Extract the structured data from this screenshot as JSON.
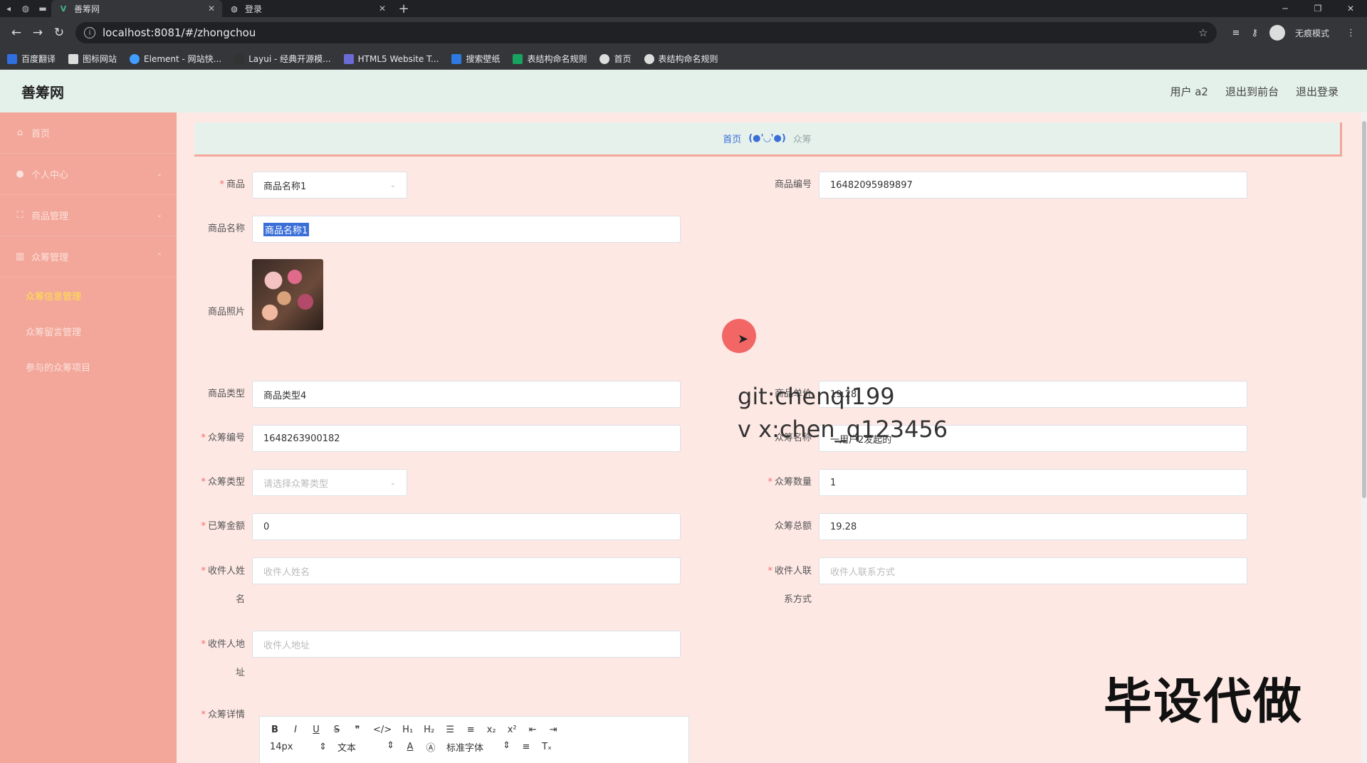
{
  "browser": {
    "tabs": [
      {
        "title": "善筹网",
        "active": true
      },
      {
        "title": "登录",
        "active": false
      }
    ],
    "url": "localhost:8081/#/zhongchou",
    "incognito_label": "无痕模式",
    "bookmarks": [
      "百度翻译",
      "图标网站",
      "Element - 网站快...",
      "Layui - 经典开源模...",
      "HTML5 Website T...",
      "搜索壁纸",
      "表结构命名规则",
      "首页",
      "表结构命名规则"
    ]
  },
  "header": {
    "logo": "善筹网",
    "user": "用户 a2",
    "back_front": "退出到前台",
    "logout": "退出登录"
  },
  "sidebar": {
    "items": [
      {
        "label": "首页",
        "icon": "home-icon"
      },
      {
        "label": "个人中心",
        "icon": "user-icon"
      },
      {
        "label": "商品管理",
        "icon": "grid-icon"
      },
      {
        "label": "众筹管理",
        "icon": "chart-icon"
      }
    ],
    "subitems": [
      {
        "label": "众筹信息管理",
        "active": true
      },
      {
        "label": "众筹留言管理",
        "active": false
      },
      {
        "label": "参与的众筹项目",
        "active": false
      }
    ]
  },
  "breadcrumb": {
    "home": "首页",
    "sep": "(●'◡'●)",
    "current": "众筹"
  },
  "form": {
    "product_label": "商品",
    "product_value": "商品名称1",
    "product_no_label": "商品编号",
    "product_no_value": "16482095989897",
    "product_name_label": "商品名称",
    "product_name_value": "商品名称1",
    "photo_label": "商品照片",
    "product_type_label": "商品类型",
    "product_type_value": "商品类型4",
    "price_label": "商品单价",
    "price_value": "19.28",
    "cf_no_label": "众筹编号",
    "cf_no_value": "1648263900182",
    "cf_name_label": "众筹名称",
    "cf_name_value": "一用户2发起的",
    "cf_type_label": "众筹类型",
    "cf_type_placeholder": "请选择众筹类型",
    "cf_qty_label": "众筹数量",
    "cf_qty_value": "1",
    "raised_label": "已筹金额",
    "raised_value": "0",
    "total_label": "众筹总额",
    "total_value": "19.28",
    "receiver_name_label_1": "收件人姓",
    "receiver_name_label_2": "名",
    "receiver_name_placeholder": "收件人姓名",
    "receiver_contact_label_1": "收件人联",
    "receiver_contact_label_2": "系方式",
    "receiver_contact_placeholder": "收件人联系方式",
    "receiver_addr_label_1": "收件人地",
    "receiver_addr_label_2": "址",
    "receiver_addr_placeholder": "收件人地址",
    "detail_label": "众筹详情"
  },
  "editor": {
    "row1": [
      "B",
      "I",
      "U",
      "S",
      "❞",
      "</>",
      "H₁",
      "H₂",
      "☰",
      "≡",
      "x₂",
      "x²",
      "⇤",
      "⇥"
    ],
    "font_size": "14px",
    "text_type": "文本",
    "font_family": "标准字体"
  },
  "watermark": {
    "line1": "git:chenqi199",
    "line2": "v x:chen_q123456",
    "big": "毕设代做"
  }
}
